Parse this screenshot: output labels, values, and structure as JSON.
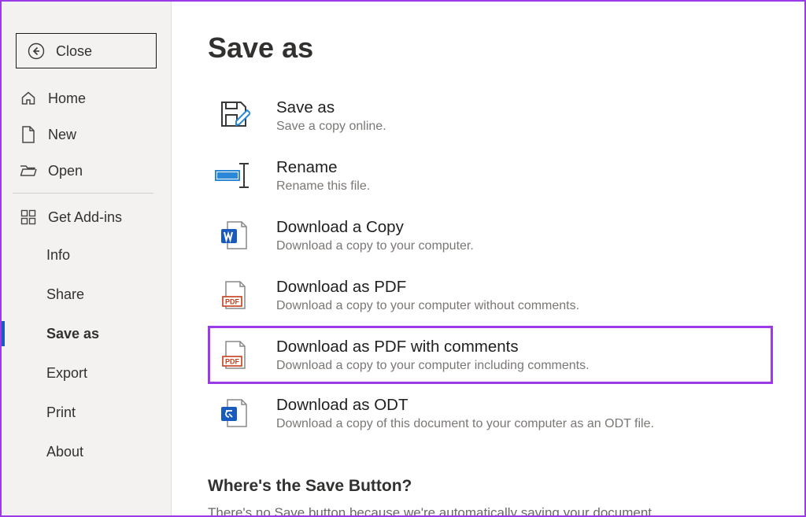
{
  "sidebar": {
    "close": {
      "label": "Close"
    },
    "home": {
      "label": "Home"
    },
    "new": {
      "label": "New"
    },
    "open": {
      "label": "Open"
    },
    "addins": {
      "label": "Get Add-ins"
    },
    "info": {
      "label": "Info"
    },
    "share": {
      "label": "Share"
    },
    "saveas": {
      "label": "Save as"
    },
    "export": {
      "label": "Export"
    },
    "print": {
      "label": "Print"
    },
    "about": {
      "label": "About"
    }
  },
  "page": {
    "title": "Save as",
    "options": {
      "saveas": {
        "title": "Save as",
        "desc": "Save a copy online."
      },
      "rename": {
        "title": "Rename",
        "desc": "Rename this file."
      },
      "downloadcopy": {
        "title": "Download a Copy",
        "desc": "Download a copy to your computer."
      },
      "downloadpdf": {
        "title": "Download as PDF",
        "desc": "Download a copy to your computer without comments."
      },
      "downloadpdfcomments": {
        "title": "Download as PDF with comments",
        "desc": "Download a copy to your computer including comments."
      },
      "downloadodt": {
        "title": "Download as ODT",
        "desc": "Download a copy of this document to your computer as an ODT file."
      }
    },
    "footer": {
      "title": "Where's the Save Button?",
      "body": "There's no Save button because we're automatically saving your document."
    }
  }
}
